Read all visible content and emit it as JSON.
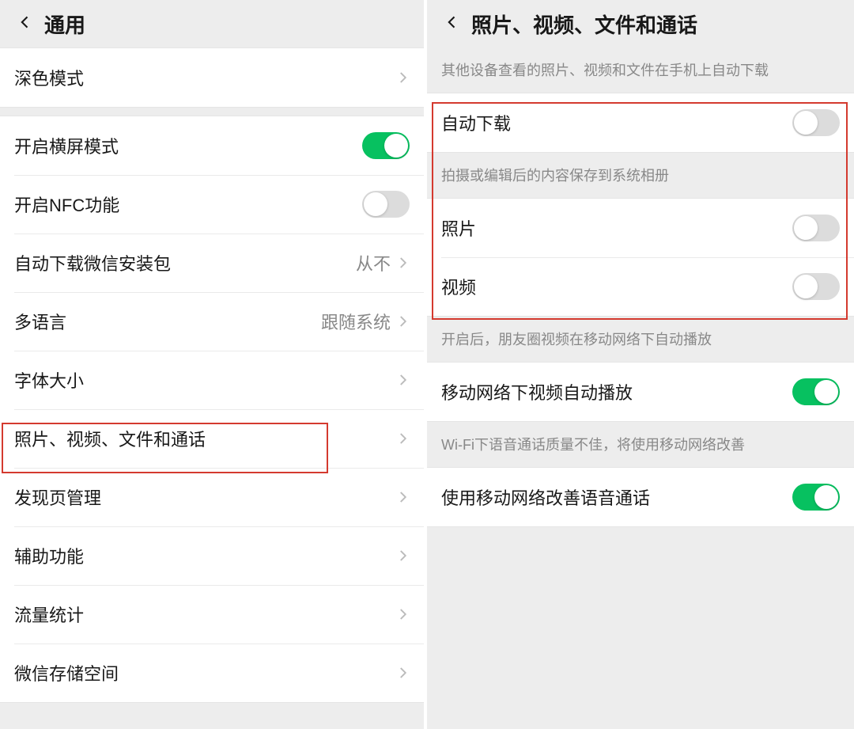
{
  "left": {
    "header_title": "通用",
    "rows": {
      "dark_mode": "深色模式",
      "landscape": "开启横屏模式",
      "nfc": "开启NFC功能",
      "auto_download_pkg_label": "自动下载微信安装包",
      "auto_download_pkg_value": "从不",
      "multi_lang_label": "多语言",
      "multi_lang_value": "跟随系统",
      "font_size": "字体大小",
      "photos_videos": "照片、视频、文件和通话",
      "discover": "发现页管理",
      "accessibility": "辅助功能",
      "data_usage": "流量统计",
      "storage": "微信存储空间"
    }
  },
  "right": {
    "header_title": "照片、视频、文件和通话",
    "section1": "其他设备查看的照片、视频和文件在手机上自动下载",
    "auto_download": "自动下载",
    "section2": "拍摄或编辑后的内容保存到系统相册",
    "photo": "照片",
    "video": "视频",
    "section3": "开启后，朋友圈视频在移动网络下自动播放",
    "mobile_autoplay": "移动网络下视频自动播放",
    "section4": "Wi-Fi下语音通话质量不佳，将使用移动网络改善",
    "improve_voice": "使用移动网络改善语音通话"
  },
  "toggles": {
    "landscape": true,
    "nfc": false,
    "auto_download": false,
    "photo": false,
    "video": false,
    "mobile_autoplay": true,
    "improve_voice": true
  }
}
